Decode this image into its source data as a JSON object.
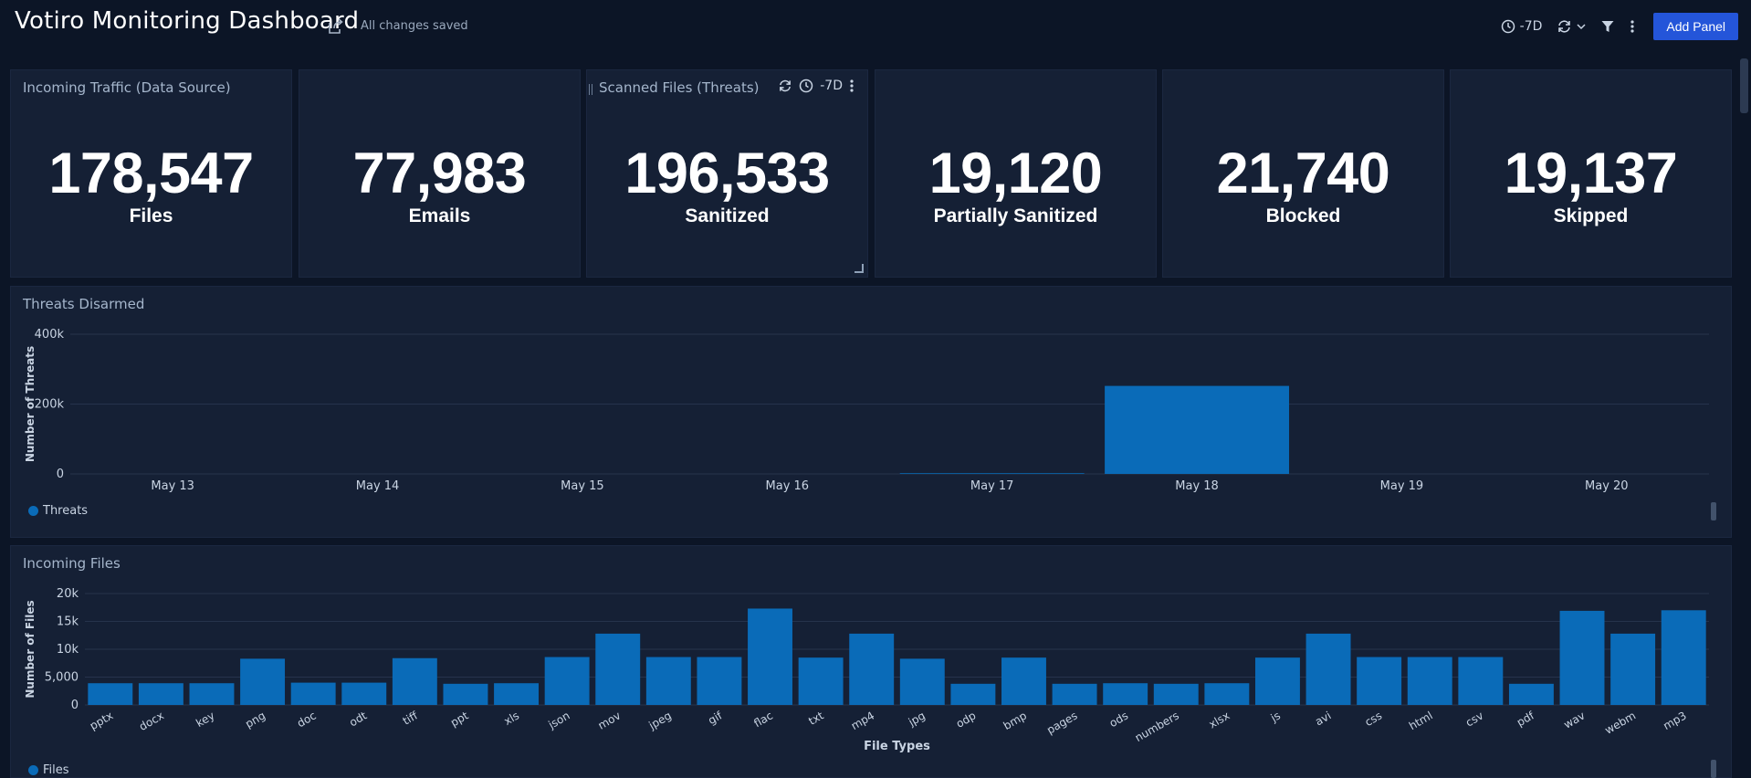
{
  "header": {
    "title": "Votiro Monitoring Dashboard",
    "save_status": "All changes saved",
    "time_range": "-7D",
    "add_panel_label": "Add Panel"
  },
  "stats": [
    {
      "title": "Incoming Traffic (Data Source)",
      "value": "178,547",
      "label": "Files"
    },
    {
      "title": "",
      "value": "77,983",
      "label": "Emails"
    },
    {
      "title": "Scanned Files (Threats)",
      "value": "196,533",
      "label": "Sanitized",
      "time_range": "-7D"
    },
    {
      "title": "",
      "value": "19,120",
      "label": "Partially Sanitized"
    },
    {
      "title": "",
      "value": "21,740",
      "label": "Blocked"
    },
    {
      "title": "",
      "value": "19,137",
      "label": "Skipped"
    }
  ],
  "threats_panel": {
    "title": "Threats Disarmed",
    "legend_label": "Threats"
  },
  "files_panel": {
    "title": "Incoming Files",
    "legend_label": "Files"
  },
  "colors": {
    "bar": "#0a6bb8",
    "accent": "#2455d9",
    "background": "#0c1526",
    "panel": "#152035"
  },
  "chart_data": [
    {
      "type": "bar",
      "title": "Threats Disarmed",
      "xlabel": "",
      "ylabel": "Number of Threats",
      "categories": [
        "May 13",
        "May 14",
        "May 15",
        "May 16",
        "May 17",
        "May 18",
        "May 19",
        "May 20"
      ],
      "series": [
        {
          "name": "Threats",
          "values": [
            0,
            0,
            0,
            0,
            2000,
            252000,
            0,
            0
          ]
        }
      ],
      "ylim": [
        0,
        400000
      ],
      "yticks": [
        0,
        200000,
        400000
      ],
      "ytick_labels": [
        "0",
        "200k",
        "400k"
      ],
      "grid": true,
      "legend": "bottom-left"
    },
    {
      "type": "bar",
      "title": "Incoming Files",
      "xlabel": "File Types",
      "ylabel": "Number of Files",
      "categories": [
        "pptx",
        "docx",
        "key",
        "png",
        "doc",
        "odt",
        "tiff",
        "ppt",
        "xls",
        "json",
        "mov",
        "jpeg",
        "gif",
        "flac",
        "txt",
        "mp4",
        "jpg",
        "odp",
        "bmp",
        "pages",
        "ods",
        "numbers",
        "xlsx",
        "js",
        "avi",
        "css",
        "html",
        "csv",
        "pdf",
        "wav",
        "webm",
        "mp3"
      ],
      "series": [
        {
          "name": "Files",
          "values": [
            3900,
            3900,
            3900,
            8300,
            4000,
            4000,
            8400,
            3800,
            3900,
            8600,
            12800,
            8600,
            8600,
            17300,
            8500,
            12800,
            8300,
            3800,
            8500,
            3800,
            3900,
            3800,
            3900,
            8500,
            12800,
            8600,
            8600,
            8600,
            3800,
            16900,
            12800,
            17000
          ]
        }
      ],
      "ylim": [
        0,
        20000
      ],
      "yticks": [
        0,
        5000,
        10000,
        15000,
        20000
      ],
      "ytick_labels": [
        "0",
        "5,000",
        "10k",
        "15k",
        "20k"
      ],
      "grid": true,
      "legend": "bottom-left"
    }
  ]
}
